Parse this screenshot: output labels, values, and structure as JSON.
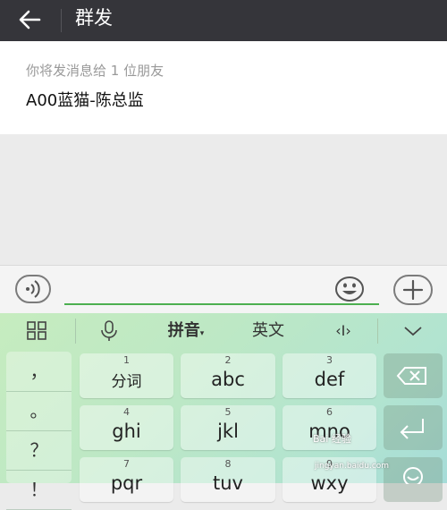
{
  "header": {
    "title": "群发"
  },
  "recipients": {
    "hint": "你将发消息给 1 位朋友",
    "name": "A00蓝猫-陈总监"
  },
  "input": {
    "value": "",
    "placeholder": ""
  },
  "keyboard": {
    "toolbar": {
      "pinyin": "拼音",
      "english": "英文",
      "cursor": "‹I›"
    },
    "punctuation": [
      "，",
      "。",
      "？",
      "！"
    ],
    "keys": [
      {
        "num": "1",
        "label": "分词"
      },
      {
        "num": "2",
        "label": "abc"
      },
      {
        "num": "3",
        "label": "def"
      },
      {
        "num": "4",
        "label": "ghi"
      },
      {
        "num": "5",
        "label": "jkl"
      },
      {
        "num": "6",
        "label": "mno"
      },
      {
        "num": "7",
        "label": "pqr"
      },
      {
        "num": "8",
        "label": "tuv"
      },
      {
        "num": "9",
        "label": "wxy"
      }
    ]
  },
  "watermark": {
    "text": "Bai 经验",
    "url": "jingyan.baidu.com"
  },
  "colors": {
    "header_bg": "#35353a",
    "accent": "#4caf50"
  }
}
